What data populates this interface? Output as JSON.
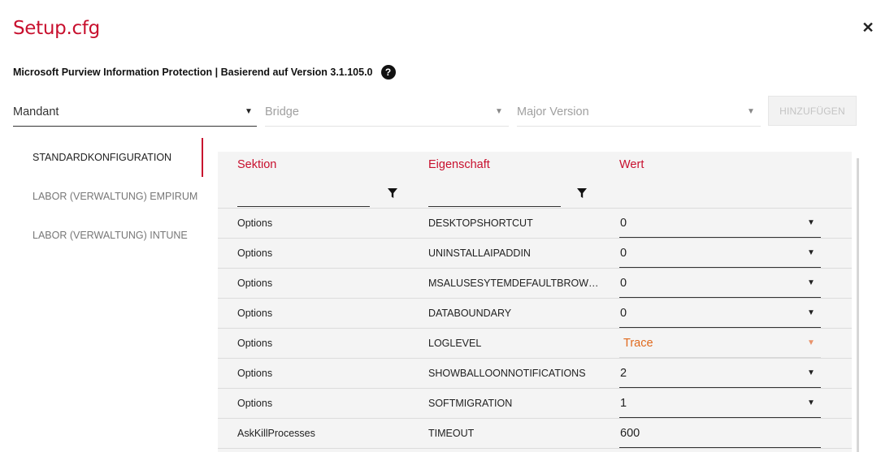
{
  "dialog": {
    "title": "Setup.cfg",
    "subtitle": "Microsoft Purview Information Protection | Basierend auf Version 3.1.105.0"
  },
  "selectors": {
    "mandant": "Mandant",
    "bridge": "Bridge",
    "major_version": "Major Version",
    "add_button": "HINZUFÜGEN"
  },
  "sidebar": {
    "items": [
      {
        "label": "STANDARDKONFIGURATION",
        "active": true
      },
      {
        "label": "LABOR (VERWALTUNG) EMPIRUM",
        "active": false
      },
      {
        "label": "LABOR (VERWALTUNG) INTUNE",
        "active": false
      }
    ]
  },
  "table": {
    "headers": {
      "section": "Sektion",
      "property": "Eigenschaft",
      "value": "Wert"
    },
    "rows": [
      {
        "section": "Options",
        "property": "DESKTOPSHORTCUT",
        "value": "0",
        "dropdown": true
      },
      {
        "section": "Options",
        "property": "UNINSTALLAIPADDIN",
        "value": "0",
        "dropdown": true
      },
      {
        "section": "Options",
        "property": "MSALUSESYTEMDEFAULTBROW…",
        "value": "0",
        "dropdown": true
      },
      {
        "section": "Options",
        "property": "DATABOUNDARY",
        "value": "0",
        "dropdown": true
      },
      {
        "section": "Options",
        "property": "LOGLEVEL",
        "value": "Trace",
        "dropdown": true,
        "highlight": true
      },
      {
        "section": "Options",
        "property": "SHOWBALLOONNOTIFICATIONS",
        "value": "2",
        "dropdown": true
      },
      {
        "section": "Options",
        "property": "SOFTMIGRATION",
        "value": "1",
        "dropdown": true
      },
      {
        "section": "AskKillProcesses",
        "property": "TIMEOUT",
        "value": "600",
        "dropdown": false
      }
    ]
  },
  "colors": {
    "accent": "#c8102e",
    "warning": "#e06a1e"
  }
}
